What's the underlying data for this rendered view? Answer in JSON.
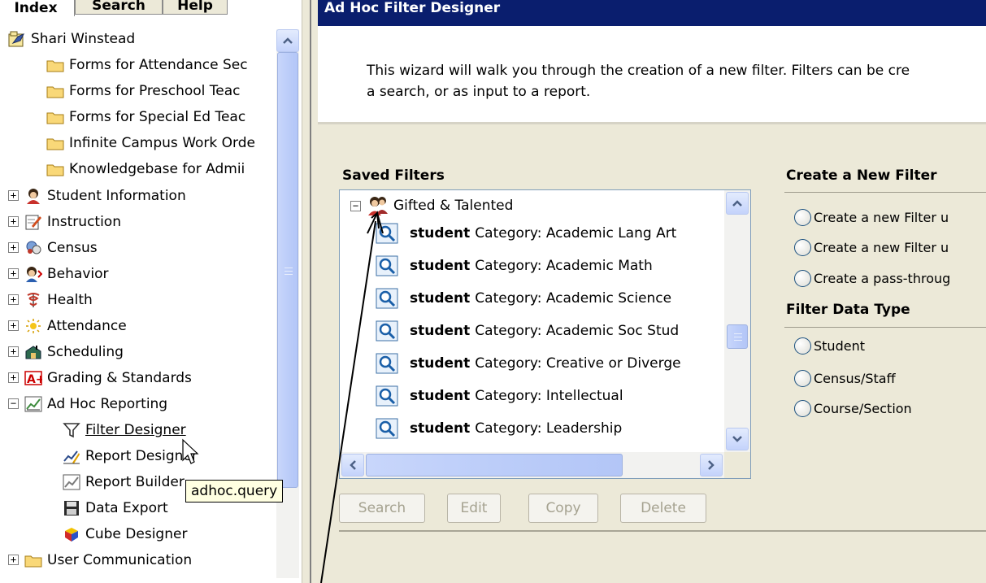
{
  "tabs": [
    {
      "label": "Index"
    },
    {
      "label": "Search"
    },
    {
      "label": "Help"
    }
  ],
  "tree": {
    "user": "Shari Winstead",
    "folders": [
      "Forms for Attendance Sec",
      "Forms for Preschool Teac",
      "Forms for Special Ed Teac",
      "Infinite Campus Work Orde",
      "Knowledgebase for Admii"
    ],
    "modules": [
      {
        "label": "Student Information",
        "expander": "+"
      },
      {
        "label": "Instruction",
        "expander": "+"
      },
      {
        "label": "Census",
        "expander": "+"
      },
      {
        "label": "Behavior",
        "expander": "+"
      },
      {
        "label": "Health",
        "expander": "+"
      },
      {
        "label": "Attendance",
        "expander": "+"
      },
      {
        "label": "Scheduling",
        "expander": "+"
      },
      {
        "label": "Grading & Standards",
        "expander": "+"
      },
      {
        "label": "Ad Hoc Reporting",
        "expander": "−"
      }
    ],
    "adhoc_children": [
      "Filter Designer",
      "Report Designer",
      "Report Builder",
      "Data Export",
      "Cube Designer"
    ],
    "last_module": {
      "label": "User Communication",
      "expander": "+"
    }
  },
  "tooltip": "adhoc.query",
  "panel": {
    "title": "Ad Hoc Filter Designer",
    "intro_line1": "This wizard will walk you through the creation of a new filter. Filters can be cre",
    "intro_line2": "a search, or as input to a report.",
    "saved_filters_heading": "Saved Filters",
    "group_label": "Gifted & Talented",
    "group_expander": "−",
    "filter_prefix": "student",
    "filters": [
      "Category: Academic Lang Art",
      "Category: Academic Math",
      "Category: Academic Science",
      "Category: Academic Soc Stud",
      "Category: Creative or Diverge",
      "Category: Intellectual",
      "Category: Leadership"
    ],
    "buttons": {
      "search": "Search",
      "edit": "Edit",
      "copy": "Copy",
      "delete": "Delete"
    },
    "create_heading": "Create a New Filter",
    "create_options": [
      "Create a new Filter u",
      "Create a new Filter u",
      "Create a pass-throug"
    ],
    "data_type_heading": "Filter Data Type",
    "data_types": [
      "Student",
      "Census/Staff",
      "Course/Section"
    ]
  },
  "colors": {
    "titlebar": "#0a1e6e",
    "panel_bg": "#ece9d8",
    "scrollbar": "#c4d3fb",
    "radio_border": "#1c5180"
  }
}
